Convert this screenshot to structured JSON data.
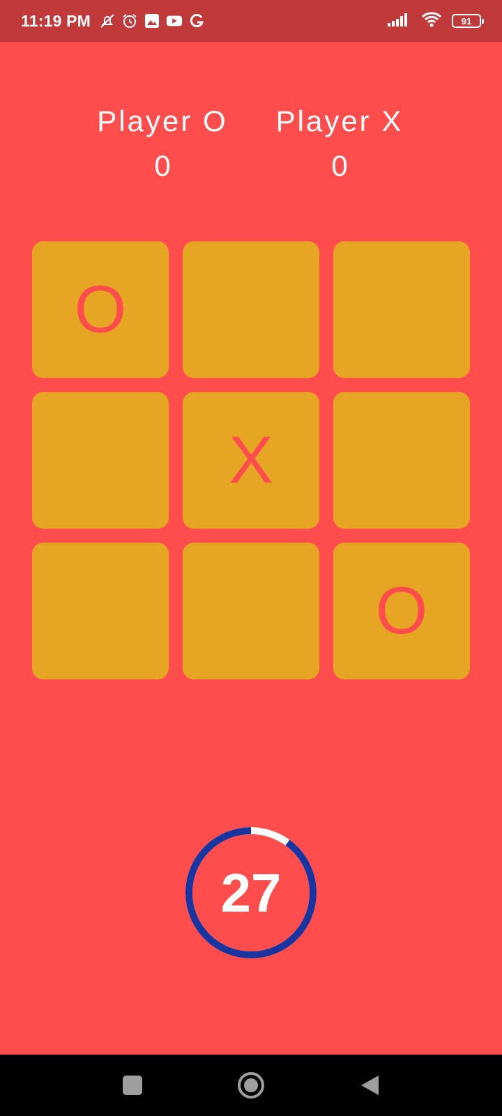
{
  "status_bar": {
    "time": "11:19 PM",
    "battery": "91",
    "icons": [
      "mute-notifications-icon",
      "alarm-icon",
      "gallery-icon",
      "youtube-icon",
      "g-app-icon",
      "signal-icon",
      "wifi-icon",
      "battery-icon"
    ]
  },
  "players": [
    {
      "name": "Player O",
      "score": "0"
    },
    {
      "name": "Player X",
      "score": "0"
    }
  ],
  "board": {
    "cells": [
      "O",
      "",
      "",
      "",
      "X",
      "",
      "",
      "",
      "O"
    ]
  },
  "timer": {
    "value": "27",
    "remaining_fraction": 0.9,
    "ring_color": "#1A35A0",
    "elapsed_color": "#FFFFFF"
  },
  "colors": {
    "background": "#FF4D4D",
    "status_bar": "#C0393B",
    "cell": "#E6A623",
    "mark": "#FF4D4D"
  },
  "nav_bar": {
    "icons": [
      "recent-apps-icon",
      "home-icon",
      "back-icon"
    ]
  }
}
